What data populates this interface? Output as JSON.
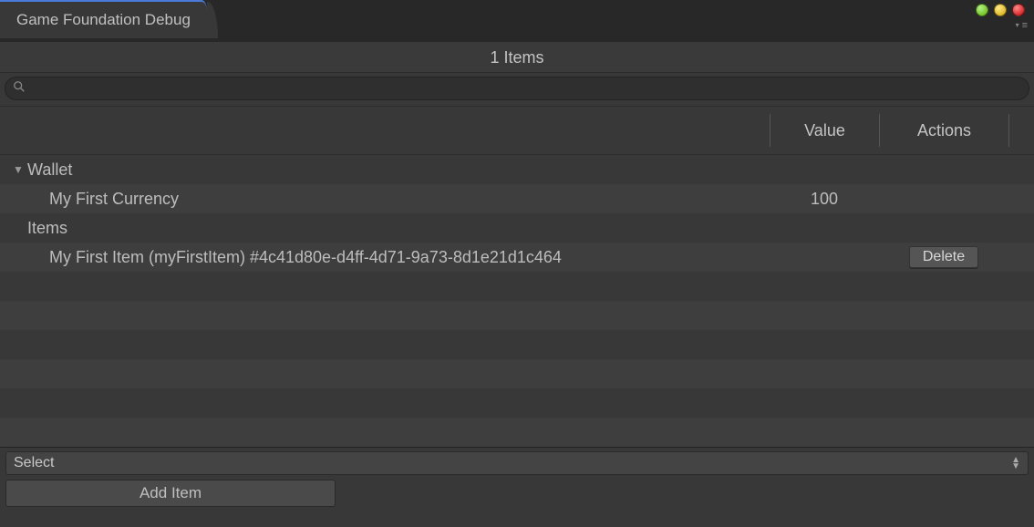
{
  "tab": {
    "title": "Game Foundation Debug"
  },
  "header": {
    "items_count_label": "1 Items"
  },
  "search": {
    "placeholder": ""
  },
  "columns": {
    "value": "Value",
    "actions": "Actions"
  },
  "wallet": {
    "section_label": "Wallet",
    "expanded": true,
    "entries": [
      {
        "label": "My First Currency",
        "value": "100"
      }
    ]
  },
  "items": {
    "section_label": "Items",
    "entries": [
      {
        "label": "My First Item (myFirstItem) #4c41d80e-d4ff-4d71-9a73-8d1e21d1c464",
        "delete_label": "Delete"
      }
    ]
  },
  "footer": {
    "select_label": "Select",
    "add_item_label": "Add Item"
  }
}
